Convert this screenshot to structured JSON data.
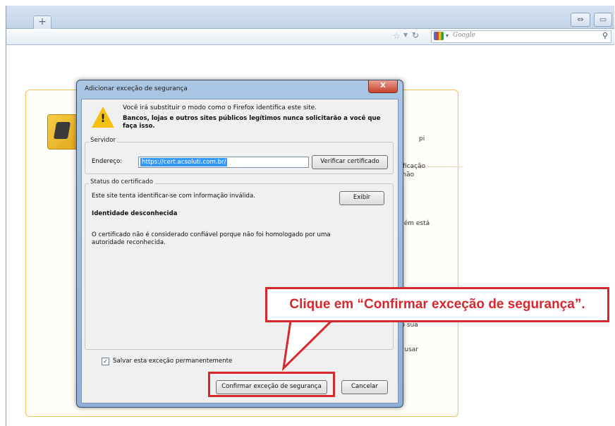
{
  "browser": {
    "new_tab_label": "+",
    "window_buttons": [
      "⇔",
      "▭"
    ],
    "search_placeholder": "Google",
    "search_icon": "magnifier-icon"
  },
  "background_page": {
    "fragments": [
      "pi",
      "tificação",
      "ı não",
      "uém está",
      "ão sua",
      "o usar"
    ]
  },
  "dialog": {
    "title": "Adicionar exceção de segurança",
    "close_label": "X",
    "warning_line1": "Você irá substituir o modo como o Firefox identifica este site.",
    "warning_line2": "Bancos, lojas e outros sites públicos legítimos nunca solicitarão a você que",
    "warning_line3": "faça isso.",
    "server": {
      "group_label": "Servidor",
      "address_label": "Endereço:",
      "address_value": "https://cert.acsoluti.com.br/",
      "verify_button": "Verificar certificado"
    },
    "certificate": {
      "group_label": "Status do certificado",
      "status_text": "Este site tenta identificar-se com informação inválida.",
      "view_button": "Exibir",
      "identity_heading": "Identidade desconhecida",
      "detail_line1": "O certificado não é considerado confiável porque não foi homologado por uma",
      "detail_line2": "autoridade reconhecida."
    },
    "save_permanently_label": "Salvar esta exceção permanentemente",
    "save_permanently_checked": true,
    "confirm_button": "Confirmar exceção de segurança",
    "cancel_button": "Cancelar"
  },
  "annotation": {
    "callout_text": "Clique em “Confirmar exceção de segurança”.",
    "color": "#d8282f"
  }
}
